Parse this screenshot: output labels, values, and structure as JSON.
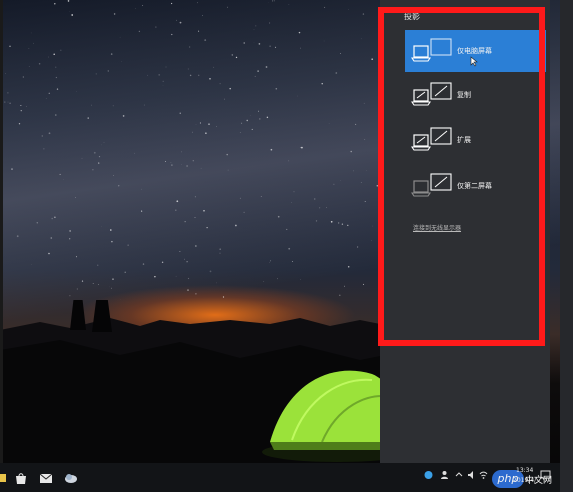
{
  "panel": {
    "title": "投影",
    "options": [
      {
        "label": "仅电脑屏幕",
        "selected": true
      },
      {
        "label": "复制",
        "selected": false
      },
      {
        "label": "扩展",
        "selected": false
      },
      {
        "label": "仅第二屏幕",
        "selected": false
      }
    ],
    "wireless_link": "连接到无线显示器"
  },
  "highlight_color": "#ff1a1a",
  "accent_color": "#2b7fd6",
  "taskbar": {
    "time": "13:34",
    "date": "2019/4/",
    "icons": [
      "store-icon",
      "mail-icon",
      "cloud-icon"
    ],
    "tray": [
      "network-icon",
      "people-icon",
      "chevron-up-icon",
      "speaker-icon",
      "wifi-icon",
      "notification-icon"
    ]
  },
  "watermark": {
    "logo": "php",
    "text": "中文网"
  }
}
